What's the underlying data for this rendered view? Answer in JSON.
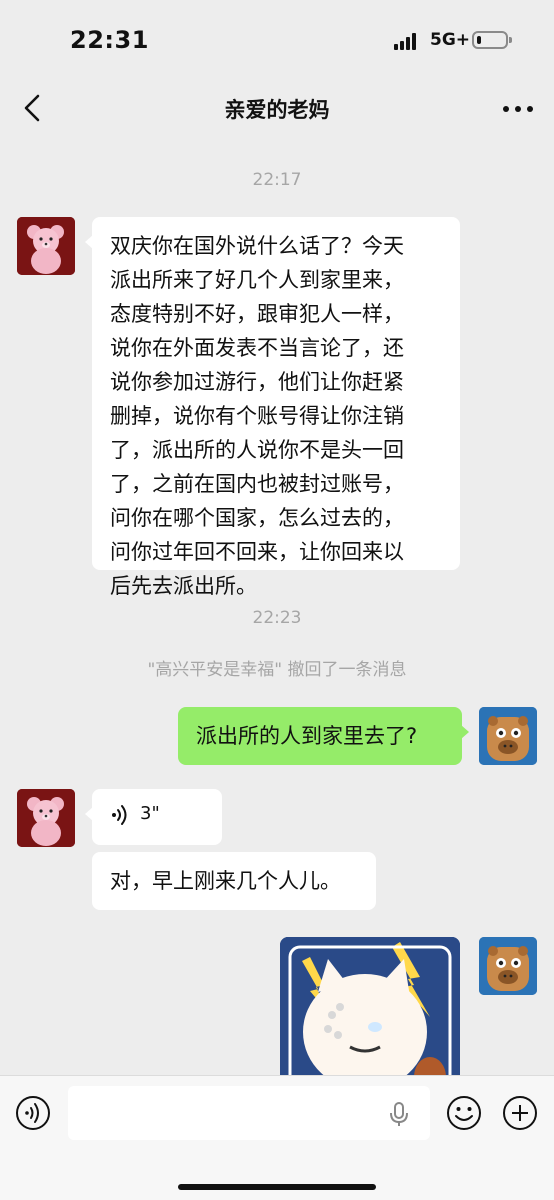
{
  "status_bar": {
    "time": "22:31",
    "network": "5G+",
    "battery_level": 0.15
  },
  "nav": {
    "title": "亲爱的老妈"
  },
  "chat": {
    "timestamp_1": "22:17",
    "mom_message_1": "双庆你在国外说什么话了？今天\n派出所来了好几个人到家里来，\n态度特别不好，跟审犯人一样，\n说你在外面发表不当言论了，还\n说你参加过游行，他们让你赶紧\n删掉，说你有个账号得让你注销\n了，派出所的人说你不是头一回\n了，之前在国内也被封过账号，\n问你在哪个国家，怎么过去的，\n问你过年回不回来，让你回来以\n后先去派出所。",
    "timestamp_2": "22:23",
    "recall_notice": "\"高兴平安是幸福\" 撤回了一条消息",
    "my_message_1": "派出所的人到家里去了?",
    "mom_voice_duration": "3\"",
    "mom_message_2": "对，早上刚来几个人儿。"
  },
  "colors": {
    "my_bubble": "#95ec69",
    "their_bubble": "#ffffff",
    "background": "#ededed"
  },
  "icons": {
    "back": "chevron-left-icon",
    "more": "more-dots-icon",
    "voice_message": "voice-wave-icon",
    "voice_toggle": "voice-input-icon",
    "mic": "microphone-icon",
    "emoji": "emoji-icon",
    "plus": "plus-icon"
  }
}
